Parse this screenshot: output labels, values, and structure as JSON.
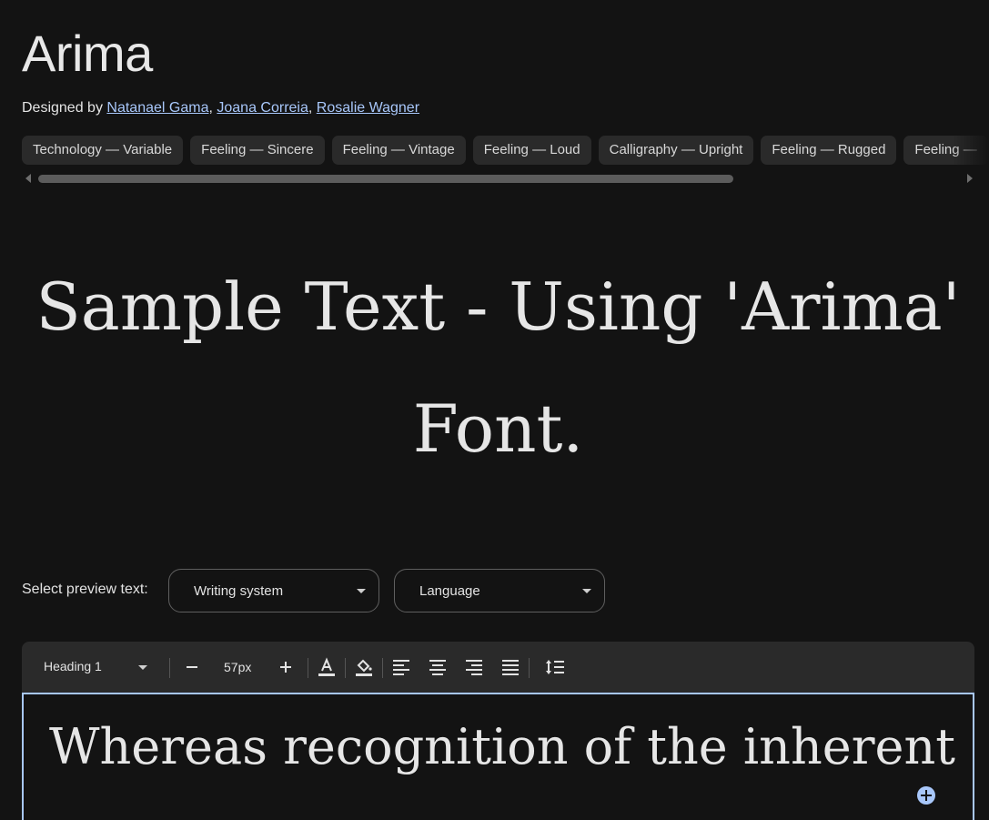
{
  "font": {
    "name": "Arima",
    "designed_by_label": "Designed by",
    "designers": [
      "Natanael Gama",
      "Joana Correia",
      "Rosalie Wagner"
    ]
  },
  "tags": [
    "Technology — Variable",
    "Feeling — Sincere",
    "Feeling — Vintage",
    "Feeling — Loud",
    "Calligraphy — Upright",
    "Feeling — Rugged",
    "Feeling —"
  ],
  "sample_text": "Sample Text - Using 'Arima' Font.",
  "preview": {
    "label": "Select preview text:",
    "writing_system": "Writing system",
    "language": "Language"
  },
  "toolbar": {
    "style": "Heading 1",
    "size": "57px"
  },
  "editor_text": "Whereas recognition of the inherent",
  "colors": {
    "link": "#a8c7fa",
    "background": "#131313",
    "chip": "#2a2a2a"
  }
}
